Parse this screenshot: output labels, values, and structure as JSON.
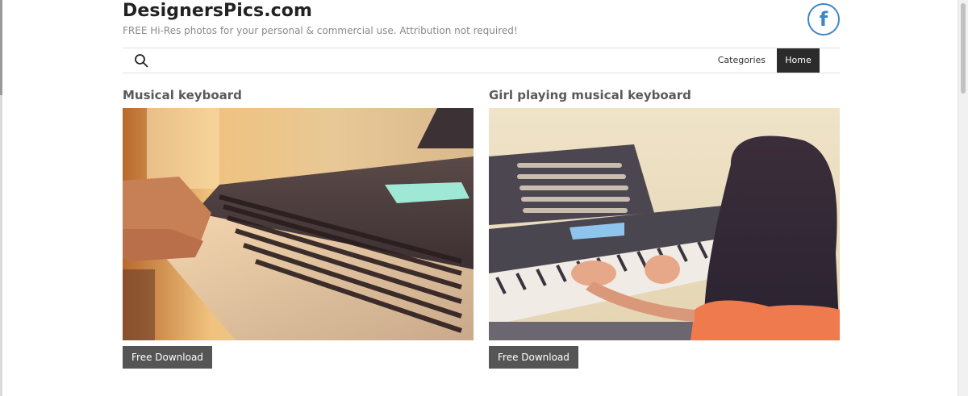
{
  "header": {
    "site_title": "DesignersPics.com",
    "tagline": "FREE Hi-Res photos for your personal & commercial use. Attribution not required!",
    "social_icon": "facebook-icon",
    "social_letter": "f",
    "brand_color": "#3f86c6"
  },
  "nav": {
    "search_icon": "search-icon",
    "items": [
      {
        "label": "Categories",
        "active": false
      },
      {
        "label": "Home",
        "active": true
      }
    ]
  },
  "posts": [
    {
      "title": "Musical keyboard",
      "image_subject": "hands playing a musical keyboard",
      "button_label": "Free Download"
    },
    {
      "title": "Girl playing musical keyboard",
      "image_subject": "girl playing a musical keyboard",
      "button_label": "Free Download"
    }
  ],
  "colors": {
    "button_bg": "#555555",
    "nav_active_bg": "#2b2b2b",
    "title_text": "#222222"
  }
}
